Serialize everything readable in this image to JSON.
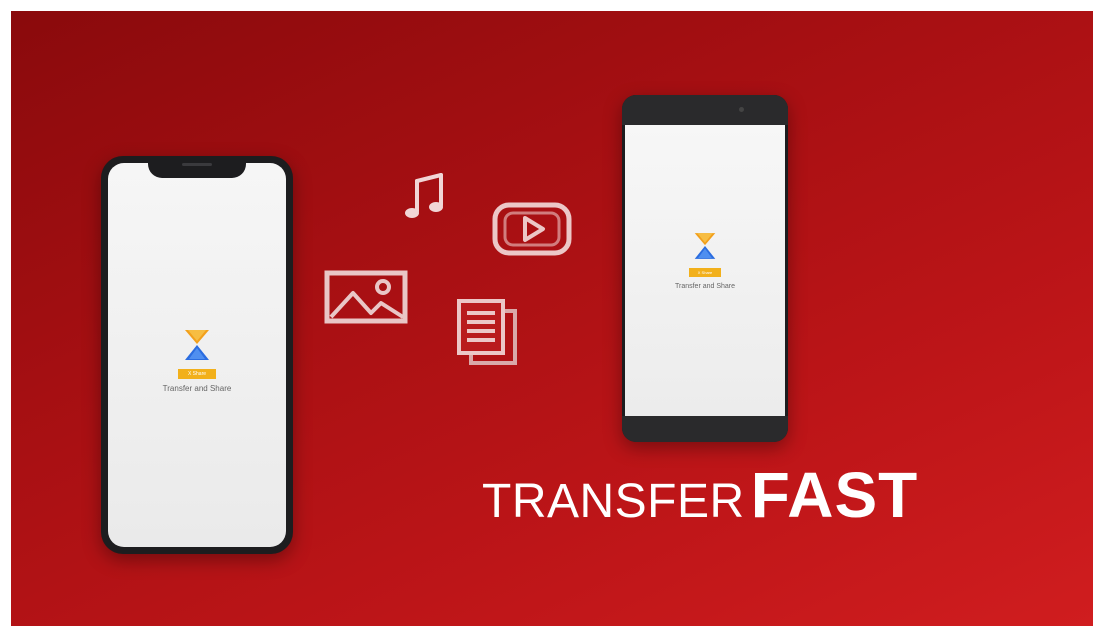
{
  "app": {
    "ribbon_text": "X Share",
    "tagline": "Transfer and Share"
  },
  "headline": {
    "light": "TRANSFER",
    "bold": "FAST"
  },
  "icons": [
    "music-note-icon",
    "video-play-icon",
    "image-icon",
    "document-icon"
  ],
  "colors": {
    "background": "#b8151a",
    "logo_orange": "#f2a01c",
    "logo_blue": "#2b6de0",
    "ribbon": "#f2b01b",
    "text": "#ffffff"
  }
}
